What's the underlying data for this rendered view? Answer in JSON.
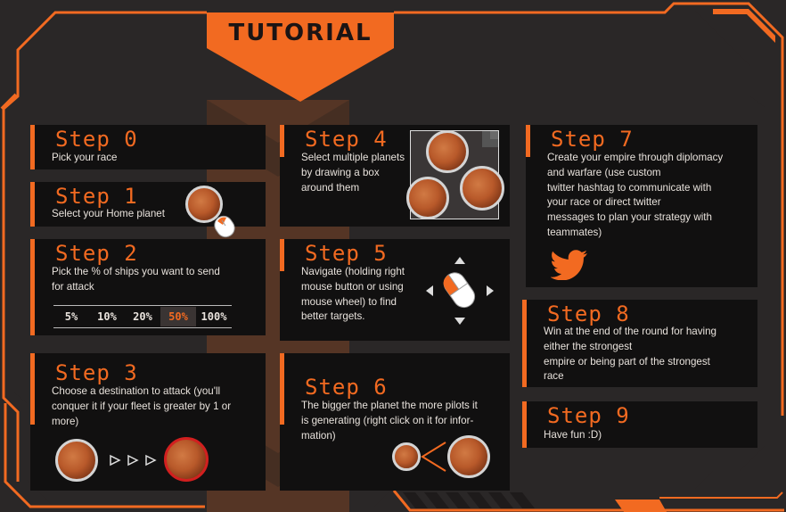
{
  "title": "TUTORIAL",
  "colors": {
    "accent": "#f26a21",
    "panel": "#111010",
    "background": "#2a2727",
    "text": "#e8e2dc",
    "danger": "#d21f1f"
  },
  "steps": [
    {
      "title": "Step 0",
      "text": "Pick your race"
    },
    {
      "title": "Step 1",
      "text": "Select your Home planet"
    },
    {
      "title": "Step 2",
      "text": "Pick the % of ships you want to send\nfor attack"
    },
    {
      "title": "Step 3",
      "text": "Choose a destination to attack (you'll\nconquer it if your fleet is greater by 1 or\nmore)"
    },
    {
      "title": "Step 4",
      "text": "Select multiple planets\nby drawing a box\naround them"
    },
    {
      "title": "Step 5",
      "text": "Navigate (holding right\nmouse button or using\nmouse wheel) to find\nbetter targets."
    },
    {
      "title": "Step 6",
      "text": "The bigger the planet the more pilots it\nis generating (right click on it for infor-\nmation)"
    },
    {
      "title": "Step 7",
      "text": "Create your empire through diplomacy\nand warfare (use custom\ntwitter hashtag to communicate with\nyour race or direct twitter\nmessages to plan your strategy with\nteammates)"
    },
    {
      "title": "Step 8",
      "text": "Win at the end of the round for having\neither the strongest\nempire or being part of the strongest\nrace"
    },
    {
      "title": "Step 9",
      "text": "Have fun :D)"
    }
  ],
  "percentages": [
    "5%",
    "10%",
    "20%",
    "50%",
    "100%"
  ],
  "selected_percentage": "50%",
  "icons": {
    "twitter": "twitter-bird-icon",
    "mouse": "mouse-icon",
    "arrows": "navigation-arrows-icon",
    "attack": "attack-arrows-icon"
  }
}
